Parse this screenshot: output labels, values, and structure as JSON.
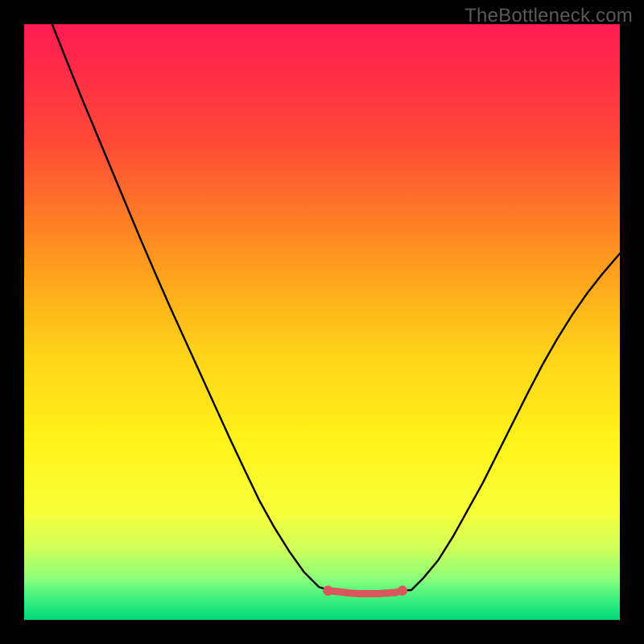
{
  "watermark": "TheBottleneck.com",
  "gradient": {
    "stops": [
      {
        "offset": 0.0,
        "color": "#ff1a52"
      },
      {
        "offset": 0.2,
        "color": "#ff4a36"
      },
      {
        "offset": 0.4,
        "color": "#ff9a1e"
      },
      {
        "offset": 0.55,
        "color": "#ffd21a"
      },
      {
        "offset": 0.7,
        "color": "#fff31a"
      },
      {
        "offset": 0.82,
        "color": "#f7ff3a"
      },
      {
        "offset": 0.88,
        "color": "#d0ff5a"
      },
      {
        "offset": 0.93,
        "color": "#8cff7a"
      },
      {
        "offset": 0.965,
        "color": "#3cf07e"
      },
      {
        "offset": 1.0,
        "color": "#00d87a"
      }
    ]
  },
  "curve": {
    "stroke": "#000000",
    "stroke_width": 2.4,
    "points": [
      [
        0.047,
        0.0
      ],
      [
        0.07,
        0.058
      ],
      [
        0.095,
        0.12
      ],
      [
        0.12,
        0.18
      ],
      [
        0.145,
        0.24
      ],
      [
        0.17,
        0.3
      ],
      [
        0.195,
        0.36
      ],
      [
        0.22,
        0.418
      ],
      [
        0.245,
        0.475
      ],
      [
        0.27,
        0.53
      ],
      [
        0.295,
        0.585
      ],
      [
        0.32,
        0.64
      ],
      [
        0.345,
        0.695
      ],
      [
        0.37,
        0.748
      ],
      [
        0.395,
        0.8
      ],
      [
        0.42,
        0.845
      ],
      [
        0.445,
        0.885
      ],
      [
        0.47,
        0.92
      ],
      [
        0.495,
        0.945
      ],
      [
        0.515,
        0.951
      ],
      [
        0.52,
        0.952
      ],
      [
        0.54,
        0.953
      ],
      [
        0.56,
        0.953
      ],
      [
        0.58,
        0.953
      ],
      [
        0.6,
        0.953
      ],
      [
        0.62,
        0.953
      ],
      [
        0.63,
        0.951
      ],
      [
        0.65,
        0.95
      ],
      [
        0.67,
        0.93
      ],
      [
        0.695,
        0.9
      ],
      [
        0.72,
        0.86
      ],
      [
        0.745,
        0.815
      ],
      [
        0.77,
        0.77
      ],
      [
        0.795,
        0.72
      ],
      [
        0.82,
        0.67
      ],
      [
        0.845,
        0.62
      ],
      [
        0.87,
        0.572
      ],
      [
        0.895,
        0.528
      ],
      [
        0.92,
        0.488
      ],
      [
        0.945,
        0.452
      ],
      [
        0.97,
        0.42
      ],
      [
        1.0,
        0.385
      ]
    ]
  },
  "highlight": {
    "stroke": "#d9575c",
    "stroke_width": 9,
    "dot_radius": 6.2,
    "start": [
      0.51,
      0.951
    ],
    "end": [
      0.635,
      0.951
    ],
    "mid": [
      [
        0.53,
        0.953
      ],
      [
        0.546,
        0.955
      ],
      [
        0.562,
        0.956
      ],
      [
        0.578,
        0.956
      ],
      [
        0.594,
        0.956
      ],
      [
        0.61,
        0.955
      ],
      [
        0.624,
        0.954
      ]
    ]
  },
  "chart_data": {
    "type": "line",
    "title": "",
    "xlabel": "",
    "ylabel": "",
    "x_range": [
      0,
      1
    ],
    "y_range": [
      0,
      1
    ],
    "legend": false,
    "grid": false,
    "annotations": [
      {
        "text": "TheBottleneck.com",
        "position": "top-right"
      }
    ],
    "series": [
      {
        "name": "bottleneck-curve",
        "x": [
          0.047,
          0.07,
          0.095,
          0.12,
          0.145,
          0.17,
          0.195,
          0.22,
          0.245,
          0.27,
          0.295,
          0.32,
          0.345,
          0.37,
          0.395,
          0.42,
          0.445,
          0.47,
          0.495,
          0.515,
          0.52,
          0.54,
          0.56,
          0.58,
          0.6,
          0.62,
          0.63,
          0.65,
          0.67,
          0.695,
          0.72,
          0.745,
          0.77,
          0.795,
          0.82,
          0.845,
          0.87,
          0.895,
          0.92,
          0.945,
          0.97,
          1.0
        ],
        "y": [
          1.0,
          0.942,
          0.88,
          0.82,
          0.76,
          0.7,
          0.64,
          0.582,
          0.525,
          0.47,
          0.415,
          0.36,
          0.305,
          0.252,
          0.2,
          0.155,
          0.115,
          0.08,
          0.055,
          0.049,
          0.048,
          0.047,
          0.047,
          0.047,
          0.047,
          0.047,
          0.049,
          0.05,
          0.07,
          0.1,
          0.14,
          0.185,
          0.23,
          0.28,
          0.33,
          0.38,
          0.428,
          0.472,
          0.512,
          0.548,
          0.58,
          0.615
        ]
      },
      {
        "name": "optimal-range-highlight",
        "x": [
          0.51,
          0.53,
          0.546,
          0.562,
          0.578,
          0.594,
          0.61,
          0.624,
          0.635
        ],
        "y": [
          0.049,
          0.047,
          0.045,
          0.044,
          0.044,
          0.044,
          0.045,
          0.046,
          0.049
        ]
      }
    ]
  }
}
